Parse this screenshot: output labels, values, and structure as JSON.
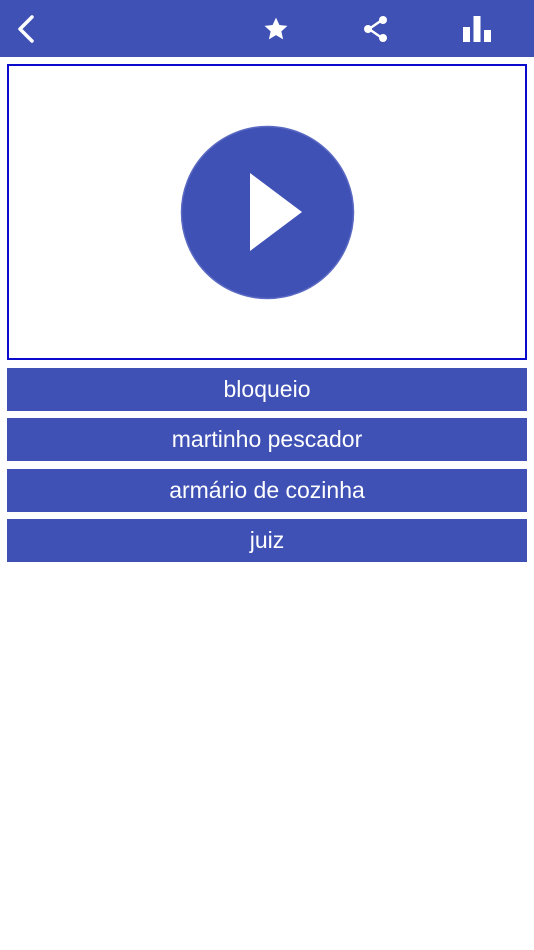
{
  "toolbar": {
    "background_color": "#3f51b5",
    "back_icon": "chevron-left-icon",
    "favorite_icon": "star-icon",
    "share_icon": "share-icon",
    "stats_icon": "bar-chart-icon"
  },
  "player": {
    "border_color": "#0a0acc",
    "play_icon": "play-icon",
    "play_circle_color": "#3f51b5"
  },
  "answers": [
    {
      "label": "bloqueio"
    },
    {
      "label": "martinho pescador"
    },
    {
      "label": "armário de cozinha"
    },
    {
      "label": "juiz"
    }
  ]
}
